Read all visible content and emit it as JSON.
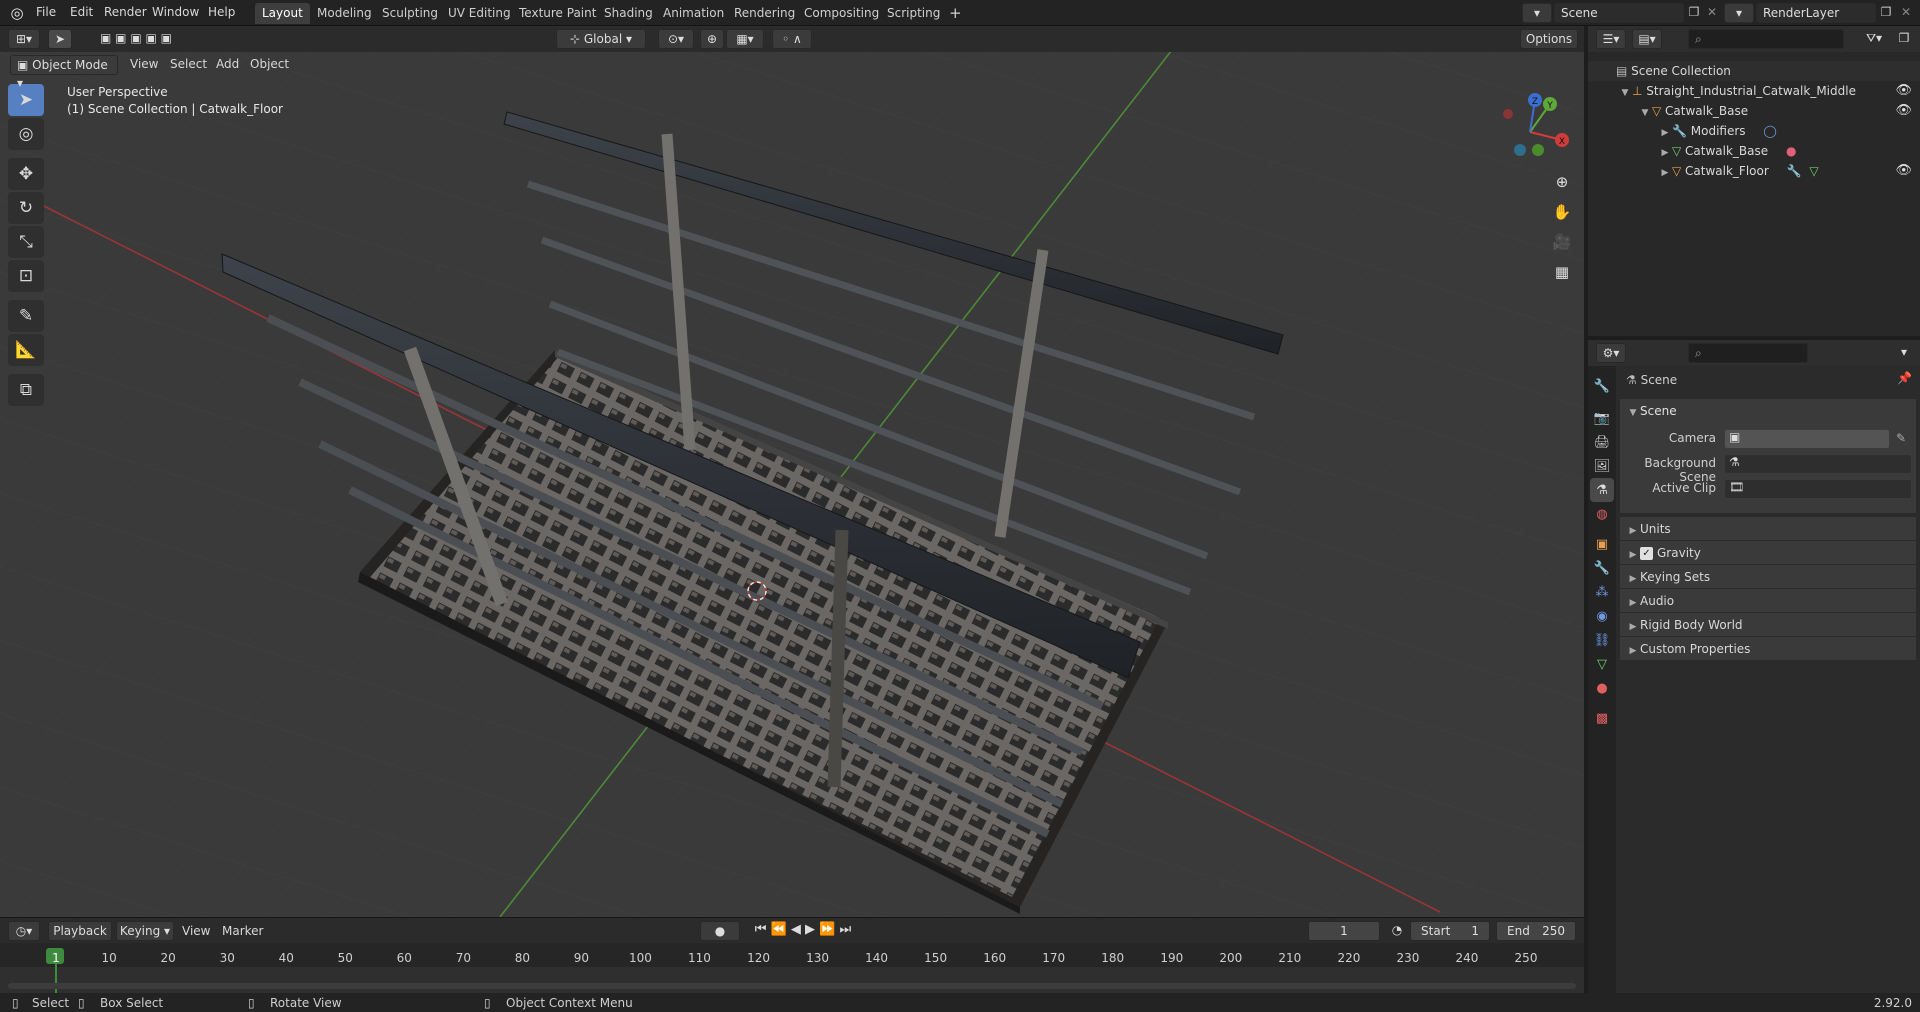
{
  "topbar": {
    "menus": [
      "File",
      "Edit",
      "Render",
      "Window",
      "Help"
    ],
    "workspaces": [
      "Layout",
      "Modeling",
      "Sculpting",
      "UV Editing",
      "Texture Paint",
      "Shading",
      "Animation",
      "Rendering",
      "Compositing",
      "Scripting"
    ],
    "active_workspace": "Layout",
    "scene_name": "Scene",
    "view_layer": "RenderLayer"
  },
  "viewport_header": {
    "mode": "Object Mode",
    "menus": [
      "View",
      "Select",
      "Add",
      "Object"
    ],
    "transform_orientation": "Global",
    "options_label": "Options"
  },
  "viewport": {
    "perspective_label": "User Perspective",
    "collection_label": "(1) Scene Collection | Catwalk_Floor",
    "gizmo_axes": [
      "X",
      "Y",
      "Z"
    ]
  },
  "toolbar": {
    "tools": [
      "select-box-icon",
      "cursor-icon",
      "move-icon",
      "rotate-icon",
      "scale-icon",
      "transform-icon",
      "annotate-icon",
      "measure-icon",
      "add-cube-icon"
    ]
  },
  "outliner": {
    "rows": [
      {
        "label": "Scene Collection",
        "depth": 0,
        "visible": false
      },
      {
        "label": "Straight_Industrial_Catwalk_Middle",
        "depth": 1,
        "visible": true
      },
      {
        "label": "Catwalk_Base",
        "depth": 2,
        "visible": true
      },
      {
        "label": "Modifiers",
        "depth": 3,
        "visible": false
      },
      {
        "label": "Catwalk_Base",
        "depth": 3,
        "visible": false
      },
      {
        "label": "Catwalk_Floor",
        "depth": 3,
        "visible": true
      }
    ]
  },
  "properties": {
    "context_title": "Scene",
    "panel_title": "Scene",
    "fields": [
      {
        "label": "Camera",
        "value": ""
      },
      {
        "label": "Background Scene",
        "value": ""
      },
      {
        "label": "Active Clip",
        "value": ""
      }
    ],
    "subpanels": [
      "Units",
      "Gravity",
      "Keying Sets",
      "Audio",
      "Rigid Body World",
      "Custom Properties"
    ],
    "gravity_checked": true
  },
  "timeline_header": {
    "menus": [
      "Playback",
      "Keying",
      "View",
      "Marker"
    ],
    "current_frame": "1",
    "start_label": "Start",
    "start_value": "1",
    "end_label": "End",
    "end_value": "250"
  },
  "timeline": {
    "frames": [
      "1",
      "10",
      "20",
      "30",
      "40",
      "50",
      "60",
      "70",
      "80",
      "90",
      "100",
      "110",
      "120",
      "130",
      "140",
      "150",
      "160",
      "170",
      "180",
      "190",
      "200",
      "210",
      "220",
      "230",
      "240",
      "250"
    ]
  },
  "statusbar": {
    "select": "Select",
    "box_select": "Box Select",
    "rotate_view": "Rotate View",
    "context_menu": "Object Context Menu",
    "version": "2.92.0"
  },
  "colors": {
    "accent": "#5680c2",
    "axis_x": "#d03c3c",
    "axis_y": "#5ea83a",
    "axis_z": "#3c6ed0",
    "active_frame": "#3e8a3e"
  }
}
